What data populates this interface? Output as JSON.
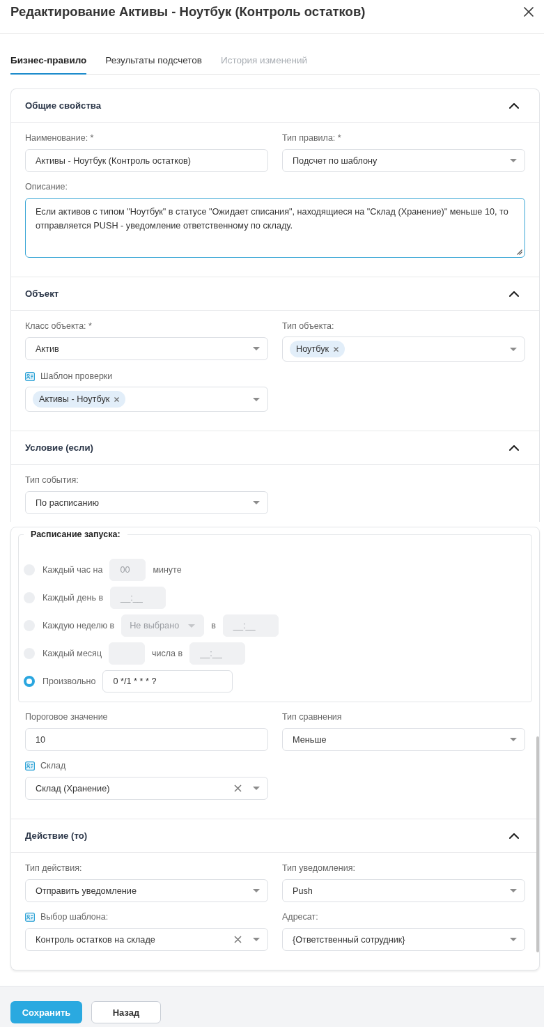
{
  "dialog": {
    "title": "Редактирование Активы - Ноутбук (Контроль остатков)"
  },
  "tabs": [
    {
      "label": "Бизнес-правило",
      "selected": true,
      "disabled": false
    },
    {
      "label": "Результаты подсчетов",
      "selected": false,
      "disabled": false
    },
    {
      "label": "История изменений",
      "selected": false,
      "disabled": true
    }
  ],
  "sections": [
    {
      "title": "Общие свойства",
      "expanded": true,
      "blocks": [
        {
          "kind": "fields",
          "fields": [
            {
              "kind": "input",
              "label": "Наименование: *",
              "label_icon": false,
              "value": "Активы - Ноутбук (Контроль остатков)"
            },
            {
              "kind": "select",
              "label": "Тип правила: *",
              "label_icon": false,
              "clearable": false,
              "value": "Подсчет по шаблону"
            }
          ]
        },
        {
          "kind": "fields",
          "fields": [
            {
              "kind": "textarea",
              "label": "Описание:",
              "label_icon": false,
              "focused": true,
              "value": "Если активов с типом \"Ноутбук\" в статусе \"Ожидает списания\", находящиеся на \"Склад (Хранение)\" меньше 10, то отправляется PUSH - уведомление ответственному по складу."
            }
          ]
        }
      ]
    },
    {
      "title": "Объект",
      "expanded": true,
      "blocks": [
        {
          "kind": "fields",
          "fields": [
            {
              "kind": "select",
              "label": "Класс объекта: *",
              "label_icon": false,
              "clearable": false,
              "value": "Актив"
            },
            {
              "kind": "tags",
              "label": "Тип объекта:",
              "label_icon": false,
              "tags": [
                "Ноутбук"
              ]
            }
          ]
        },
        {
          "kind": "fields",
          "fields": [
            {
              "kind": "tags",
              "label": "Шаблон проверки",
              "label_icon": true,
              "tags": [
                "Активы - Ноутбук"
              ]
            }
          ]
        }
      ]
    },
    {
      "title": "Условие (если)",
      "expanded": true,
      "blocks": [
        {
          "kind": "fields",
          "fields": [
            {
              "kind": "select",
              "label": "Тип события:",
              "label_icon": false,
              "clearable": false,
              "value": "По расписанию"
            }
          ]
        },
        {
          "kind": "schedule",
          "title": "Расписание запуска:",
          "options": [
            {
              "selected": false,
              "parts": [
                {
                  "kind": "label",
                  "text": "Каждый час на"
                },
                {
                  "kind": "number",
                  "placeholder": "00"
                },
                {
                  "kind": "label",
                  "text": "минуте"
                }
              ]
            },
            {
              "selected": false,
              "parts": [
                {
                  "kind": "label",
                  "text": "Каждый день в"
                },
                {
                  "kind": "time",
                  "placeholder": "__:__"
                }
              ]
            },
            {
              "selected": false,
              "parts": [
                {
                  "kind": "label",
                  "text": "Каждую неделю в"
                },
                {
                  "kind": "select",
                  "placeholder": "Не выбрано"
                },
                {
                  "kind": "label",
                  "text": "в"
                },
                {
                  "kind": "time",
                  "placeholder": "__:__"
                }
              ]
            },
            {
              "selected": false,
              "parts": [
                {
                  "kind": "label",
                  "text": "Каждый месяц"
                },
                {
                  "kind": "number"
                },
                {
                  "kind": "label",
                  "text": "числа в"
                },
                {
                  "kind": "time",
                  "placeholder": "__:__"
                }
              ]
            },
            {
              "selected": true,
              "parts": [
                {
                  "kind": "label",
                  "text": "Произвольно"
                },
                {
                  "kind": "expression",
                  "value": "0 */1 * * * ?"
                }
              ]
            }
          ]
        },
        {
          "kind": "fields",
          "fields": [
            {
              "kind": "input",
              "label": "Пороговое значение",
              "label_icon": false,
              "value": "10"
            },
            {
              "kind": "select",
              "label": "Тип сравнения",
              "label_icon": false,
              "clearable": false,
              "value": "Меньше"
            }
          ]
        },
        {
          "kind": "fields",
          "fields": [
            {
              "kind": "select",
              "label": "Склад",
              "label_icon": true,
              "clearable": true,
              "value": "Склад (Хранение)"
            }
          ]
        }
      ]
    },
    {
      "title": "Действие (то)",
      "expanded": true,
      "blocks": [
        {
          "kind": "fields",
          "fields": [
            {
              "kind": "select",
              "label": "Тип действия:",
              "label_icon": false,
              "clearable": false,
              "value": "Отправить уведомление"
            },
            {
              "kind": "select",
              "label": "Тип уведомления:",
              "label_icon": false,
              "clearable": false,
              "value": "Push"
            }
          ]
        },
        {
          "kind": "fields",
          "fields": [
            {
              "kind": "select",
              "label": "Выбор шаблона:",
              "label_icon": true,
              "clearable": true,
              "value": "Контроль остатков на складе"
            },
            {
              "kind": "select",
              "label": "Адресат:",
              "label_icon": false,
              "clearable": false,
              "value": "{Ответственный сотрудник}"
            }
          ]
        }
      ]
    }
  ],
  "buttons": [
    {
      "kind": "primary",
      "label": "Сохранить"
    },
    {
      "kind": "secondary",
      "label": "Назад"
    }
  ]
}
